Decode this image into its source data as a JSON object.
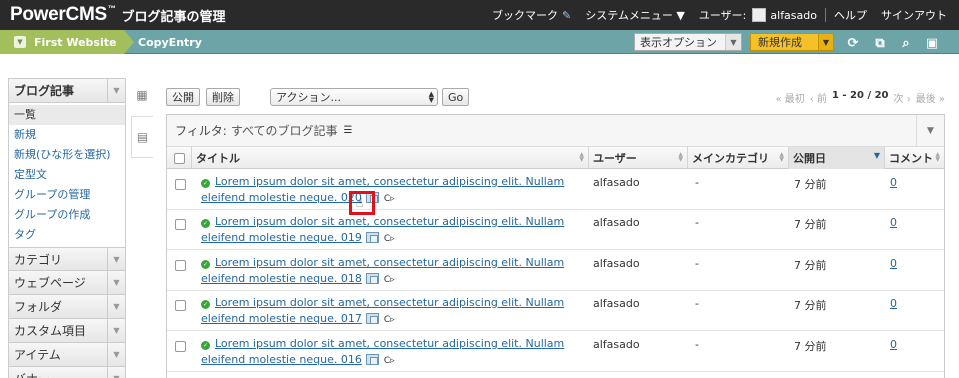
{
  "topbar": {
    "brand": "PowerCMS",
    "brand_mark": "™",
    "page_heading": "ブログ記事の管理",
    "nav": [
      {
        "label": "ブックマーク",
        "icon": "bookmark-icon"
      },
      {
        "label": "システムメニュー ▼",
        "icon": "chevron-down-icon"
      },
      {
        "label": "ユーザー:"
      },
      {
        "label": "alfasado"
      },
      {
        "label": "ヘルプ"
      },
      {
        "label": "サインアウト"
      }
    ]
  },
  "sitebar": {
    "site_name": "First Website",
    "current_mode": "CopyEntry",
    "display_options": "表示オプション",
    "new_button": "新規作成",
    "tool_icons": [
      "refresh-icon",
      "external-link-icon",
      "search-icon",
      "trash-icon"
    ]
  },
  "sidebar": {
    "open_section": "ブログ記事",
    "items": [
      "一覧",
      "新規",
      "新規(ひな形を選択)",
      "定型文",
      "グループの管理",
      "グループの作成",
      "タグ"
    ],
    "current_item": "一覧",
    "sections": [
      "カテゴリ",
      "ウェブページ",
      "フォルダ",
      "カスタム項目",
      "アイテム",
      "バナー"
    ]
  },
  "actions": {
    "publish": "公開",
    "delete": "削除",
    "action_select": "アクション...",
    "go": "Go"
  },
  "pager": {
    "first": "« 最初",
    "prev": "‹ 前",
    "range": "1 - 20 / 20",
    "next": "次 ›",
    "last": "最後 »"
  },
  "filter": {
    "label": "フィルタ:",
    "value": "すべてのブログ記事",
    "menu_icon": "list-icon"
  },
  "table": {
    "columns": [
      "タイトル",
      "ユーザー",
      "メインカテゴリ",
      "公開日",
      "コメント"
    ],
    "sorted_column": "公開日",
    "rows": [
      {
        "title_line1": "Lorem ipsum dolor sit amet, consectetur adipiscing elit. Nullam",
        "title_line2": "eleifend molestie neque. 020",
        "user": "alfasado",
        "category": "-",
        "date": "7 分前",
        "comments": "0"
      },
      {
        "title_line1": "Lorem ipsum dolor sit amet, consectetur adipiscing elit. Nullam",
        "title_line2": "eleifend molestie neque. 019",
        "user": "alfasado",
        "category": "-",
        "date": "7 分前",
        "comments": "0"
      },
      {
        "title_line1": "Lorem ipsum dolor sit amet, consectetur adipiscing elit. Nullam",
        "title_line2": "eleifend molestie neque. 018",
        "user": "alfasado",
        "category": "-",
        "date": "7 分前",
        "comments": "0"
      },
      {
        "title_line1": "Lorem ipsum dolor sit amet, consectetur adipiscing elit. Nullam",
        "title_line2": "eleifend molestie neque. 017",
        "user": "alfasado",
        "category": "-",
        "date": "7 分前",
        "comments": "0"
      },
      {
        "title_line1": "Lorem ipsum dolor sit amet, consectetur adipiscing elit. Nullam",
        "title_line2": "eleifend molestie neque. 016",
        "user": "alfasado",
        "category": "-",
        "date": "7 分前",
        "comments": "0"
      }
    ],
    "preview_glyph": "C▹"
  },
  "colors": {
    "topbar": "#2a2a2a",
    "sitebar": "#6da4a8",
    "site_switch": "#a3bf5b",
    "new_button": "#f4c128",
    "link": "#2468a2",
    "highlight": "#e1101c"
  }
}
